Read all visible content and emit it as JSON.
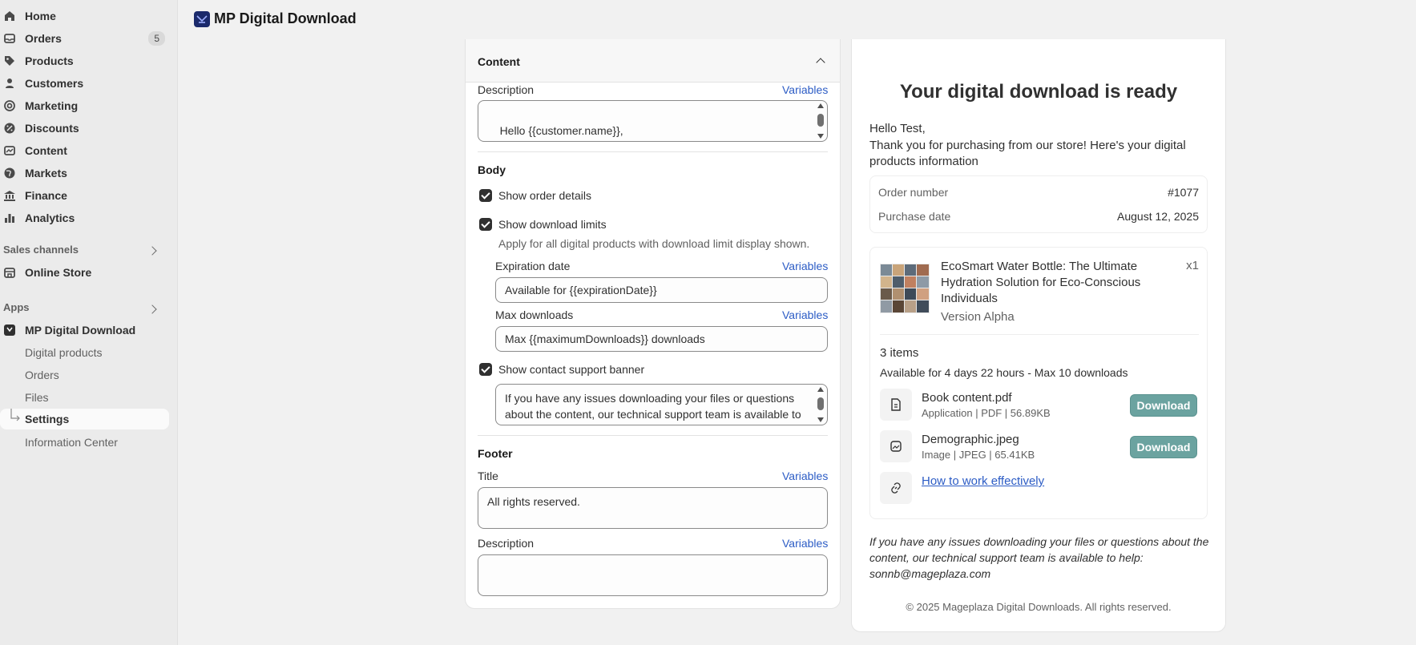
{
  "sidebar": {
    "nav": [
      {
        "label": "Home",
        "icon": "home-icon"
      },
      {
        "label": "Orders",
        "icon": "orders-icon",
        "badge": "5"
      },
      {
        "label": "Products",
        "icon": "tag-icon"
      },
      {
        "label": "Customers",
        "icon": "person-icon"
      },
      {
        "label": "Marketing",
        "icon": "target-icon"
      },
      {
        "label": "Discounts",
        "icon": "discount-icon"
      },
      {
        "label": "Content",
        "icon": "content-icon"
      },
      {
        "label": "Markets",
        "icon": "globe-icon"
      },
      {
        "label": "Finance",
        "icon": "bank-icon"
      },
      {
        "label": "Analytics",
        "icon": "bar-chart-icon"
      }
    ],
    "sales_channels_label": "Sales channels",
    "online_store": "Online Store",
    "apps_label": "Apps",
    "app_name": "MP Digital Download",
    "app_sub": [
      {
        "label": "Digital products"
      },
      {
        "label": "Orders"
      },
      {
        "label": "Files"
      },
      {
        "label": "Settings"
      },
      {
        "label": "Information Center"
      }
    ]
  },
  "topbar": {
    "title": "MP Digital Download"
  },
  "editor": {
    "section_title": "Content",
    "description_label": "Description",
    "variables": "Variables",
    "description_text": "Hello {{customer.name}},\nThank you for purchasing from our store! Here's your digital products information",
    "body_label": "Body",
    "show_order_details": "Show order details",
    "show_download_limits": "Show download limits",
    "download_limits_help": "Apply for all digital products with download limit display shown.",
    "expiration_label": "Expiration date",
    "expiration_value": "Available for {{expirationDate}}",
    "max_downloads_label": "Max downloads",
    "max_downloads_value": "Max {{maximumDownloads}} downloads",
    "show_support_banner": "Show contact support banner",
    "support_text": "If you have any issues downloading your files or questions about the content, our technical support team is available to help: sonnb@mageplaza.com",
    "footer_label": "Footer",
    "footer_title_label": "Title",
    "footer_title_value": "All rights reserved.",
    "footer_description_label": "Description",
    "footer_description_value": ""
  },
  "preview": {
    "title": "Your digital download is ready",
    "greeting": "Hello Test,",
    "intro": "Thank you for purchasing from our store! Here's your digital products information",
    "order_number_label": "Order number",
    "order_number_value": "#1077",
    "purchase_date_label": "Purchase date",
    "purchase_date_value": "August 12, 2025",
    "product_name": "EcoSmart Water Bottle: The Ultimate Hydration Solution for Eco-Conscious Individuals",
    "product_qty": "x1",
    "product_version": "Version Alpha",
    "items_count": "3 items",
    "availability": "Available for 4 days 22 hours - Max 10 downloads",
    "files": [
      {
        "name": "Book content.pdf",
        "meta": "Application | PDF | 56.89KB",
        "button": "Download",
        "icon": "file-icon"
      },
      {
        "name": "Demographic.jpeg",
        "meta": "Image | JPEG | 65.41KB",
        "button": "Download",
        "icon": "image-icon"
      }
    ],
    "link_label": "How to work effectively",
    "support_text": "If you have any issues downloading your files or questions about the content, our technical support team is available to help: sonnb@mageplaza.com",
    "footer": "© 2025 Mageplaza Digital Downloads. All rights reserved."
  },
  "colors": {
    "accent": "#2c5cc5",
    "download_button": "#6ba3a0",
    "app_logo": "#1b2a6b"
  }
}
